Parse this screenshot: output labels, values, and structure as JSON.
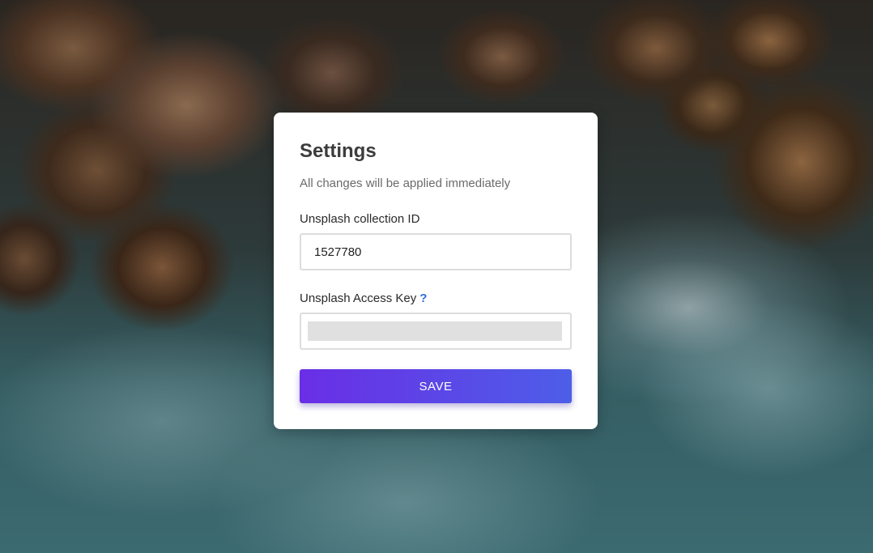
{
  "settings": {
    "title": "Settings",
    "subtitle": "All changes will be applied immediately",
    "collection": {
      "label": "Unsplash collection ID",
      "value": "1527780"
    },
    "access_key": {
      "label": "Unsplash Access Key",
      "help_label": "?"
    },
    "save_label": "SAVE"
  },
  "colors": {
    "accent_start": "#6a2ee6",
    "accent_end": "#4d5ee8",
    "help_link": "#2f6fd6"
  }
}
